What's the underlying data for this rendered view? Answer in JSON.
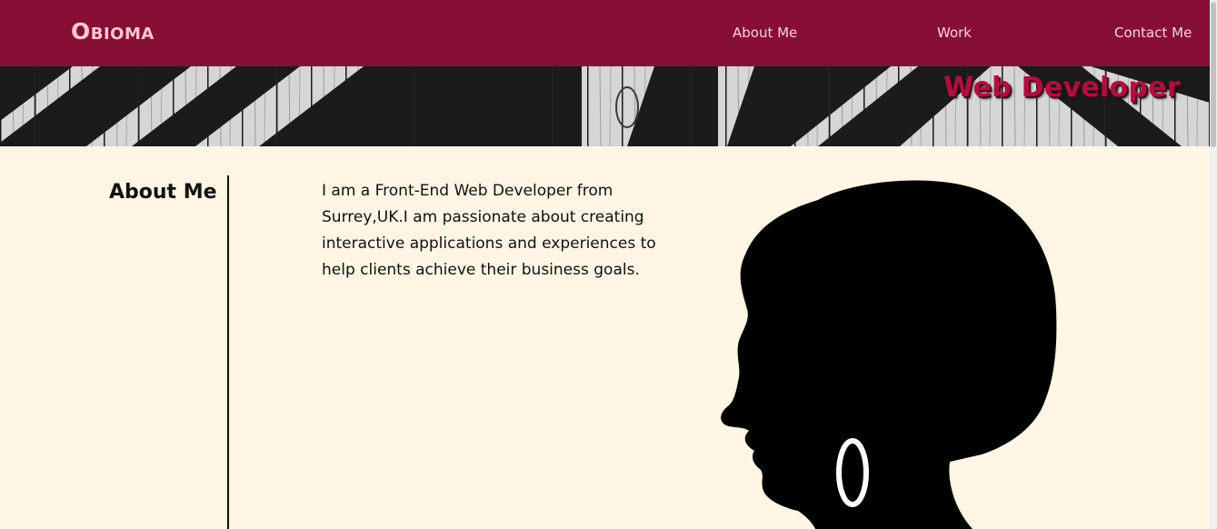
{
  "header": {
    "brand": "Obioma",
    "nav": [
      {
        "label": "About Me"
      },
      {
        "label": "Work"
      },
      {
        "label": "Contact Me"
      }
    ]
  },
  "banner": {
    "title": "Web Developer"
  },
  "about": {
    "heading": "About Me",
    "body": "I am a Front-End Web Developer from Surrey,UK.I am passionate about creating interactive applications and experiences to help clients achieve their business goals."
  },
  "icons": {
    "portrait": "woman-silhouette-hoop-earring"
  },
  "colors": {
    "nav_background": "#870e35",
    "nav_text": "#f9d2d9",
    "banner_title": "#b0103d",
    "page_background": "#fff6e5",
    "text": "#111111"
  }
}
